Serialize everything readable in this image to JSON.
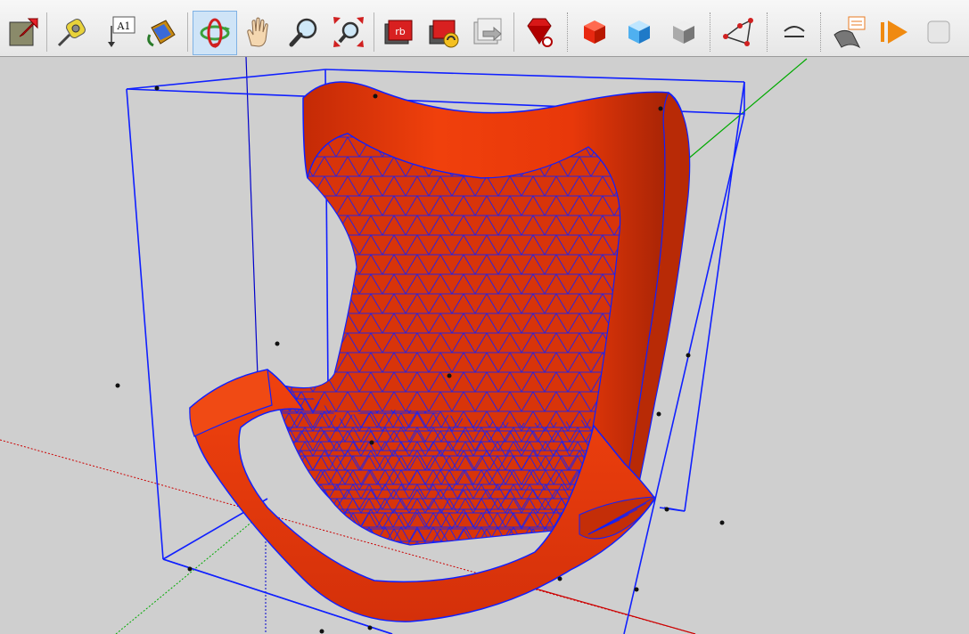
{
  "toolbar": {
    "tools": [
      {
        "name": "select-tool",
        "icon": "select-arrow-icon"
      },
      {
        "name": "tape-measure-tool",
        "icon": "tape-measure-icon"
      },
      {
        "name": "text-tool",
        "icon": "text-label-icon",
        "label": "A1"
      },
      {
        "name": "paint-bucket-tool",
        "icon": "paint-bucket-icon"
      },
      {
        "name": "orbit-tool",
        "icon": "orbit-icon",
        "active": true
      },
      {
        "name": "pan-tool",
        "icon": "hand-icon"
      },
      {
        "name": "zoom-tool",
        "icon": "magnifier-icon"
      },
      {
        "name": "zoom-extents-tool",
        "icon": "zoom-extents-icon"
      },
      {
        "name": "ruby-console-tool",
        "icon": "ruby-console-icon"
      },
      {
        "name": "plugin-sync-tool",
        "icon": "plugin-sync-icon"
      },
      {
        "name": "export-tool",
        "icon": "export-icon"
      },
      {
        "name": "ruby-gem-tool",
        "icon": "ruby-gem-icon"
      },
      {
        "name": "red-cube-tool",
        "icon": "red-cube-icon"
      },
      {
        "name": "blue-cube-tool",
        "icon": "blue-cube-icon"
      },
      {
        "name": "gray-cube-tool",
        "icon": "gray-cube-icon"
      },
      {
        "name": "polygon-tool",
        "icon": "polygon-icon"
      },
      {
        "name": "arc-tool",
        "icon": "arc-icon"
      },
      {
        "name": "layer-tool",
        "icon": "layer-sheet-icon"
      },
      {
        "name": "play-tool",
        "icon": "play-icon"
      },
      {
        "name": "stop-tool",
        "icon": "stop-icon"
      }
    ],
    "text_tool_label": "A1"
  },
  "model": {
    "name": "egg chair mesh",
    "fill_color": "#e8380a",
    "edge_color": "#0a12ff",
    "axis_colors": {
      "x": "#cc0000",
      "y": "#00aa00",
      "z": "#0000cc"
    }
  }
}
